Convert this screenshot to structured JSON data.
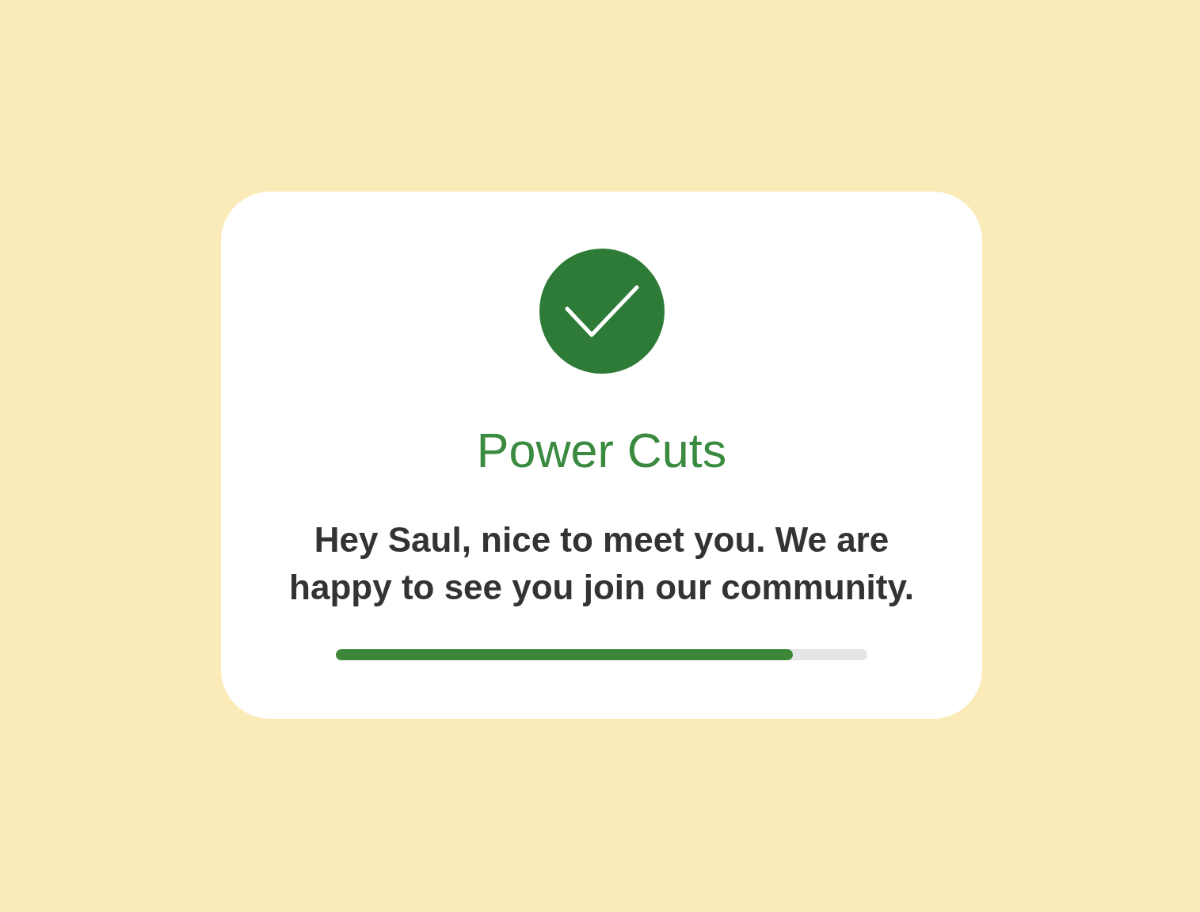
{
  "card": {
    "title": "Power Cuts",
    "message": "Hey Saul, nice to meet you. We are happy to see you join our community.",
    "progress": {
      "level": 0.86
    }
  }
}
